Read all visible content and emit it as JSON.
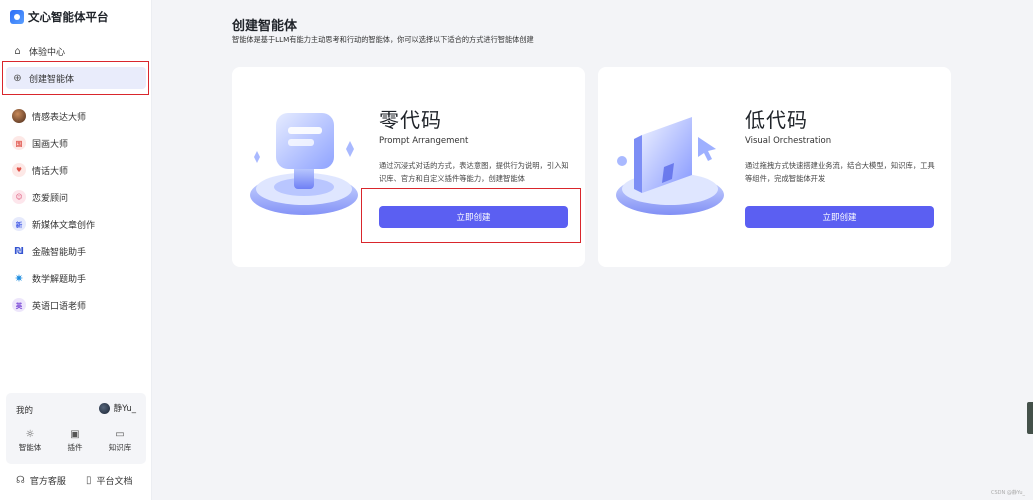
{
  "app": {
    "title": "文心智能体平台"
  },
  "sidebar": {
    "nav": [
      {
        "label": "体验中心",
        "icon": "compass-icon"
      },
      {
        "label": "创建智能体",
        "icon": "plus-circle-icon",
        "active": true
      }
    ],
    "agents": [
      {
        "label": "情感表达大师",
        "avatar": "photo"
      },
      {
        "label": "国画大师",
        "avatar": "国",
        "color": "#e0534a",
        "bg": "#fde8e6"
      },
      {
        "label": "情话大师",
        "avatar": "♥",
        "color": "#e0534a",
        "bg": "#fde8e6"
      },
      {
        "label": "恋爱顾问",
        "avatar": "☺",
        "color": "#d8456b",
        "bg": "#fde6ec"
      },
      {
        "label": "新媒体文章创作",
        "avatar": "新",
        "color": "#4b62e8",
        "bg": "#e6eafc"
      },
      {
        "label": "金融智能助手",
        "avatar": "₪",
        "color": "#3454d1",
        "bg": "#ffffff"
      },
      {
        "label": "数学解题助手",
        "avatar": "✷",
        "color": "#1d8de0",
        "bg": "#ffffff"
      },
      {
        "label": "英语口语老师",
        "avatar": "英",
        "color": "#7a48d6",
        "bg": "#ede6fb"
      }
    ],
    "my": {
      "label": "我的",
      "user_name": "静Yu_",
      "tools": [
        {
          "label": "智能体",
          "icon": "sparkle-icon"
        },
        {
          "label": "插件",
          "icon": "plugin-icon"
        },
        {
          "label": "知识库",
          "icon": "monitor-icon"
        }
      ]
    },
    "bottom_links": [
      {
        "label": "官方客服",
        "icon": "headset-icon"
      },
      {
        "label": "平台文档",
        "icon": "document-icon"
      }
    ]
  },
  "main": {
    "title": "创建智能体",
    "subtitle": "智能体是基于LLM有能力主动思考和行动的智能体，你可以选择以下适合的方式进行智能体创建",
    "cards": [
      {
        "title": "零代码",
        "subtitle_en": "Prompt Arrangement",
        "description": "通过沉浸式对话的方式，表达意图，提供行为说明，引入知识库、官方和自定义插件等能力，创建智能体",
        "button": "立即创建"
      },
      {
        "title": "低代码",
        "subtitle_en": "Visual Orchestration",
        "description": "通过拖拽方式快速搭建业务流，结合大模型，知识库，工具等组件，完成智能体开发",
        "button": "立即创建"
      }
    ]
  },
  "footer": {
    "watermark": "CSDN @静Yu_"
  },
  "colors": {
    "accent": "#5b5ff2",
    "highlight_box": "#d9262c"
  }
}
